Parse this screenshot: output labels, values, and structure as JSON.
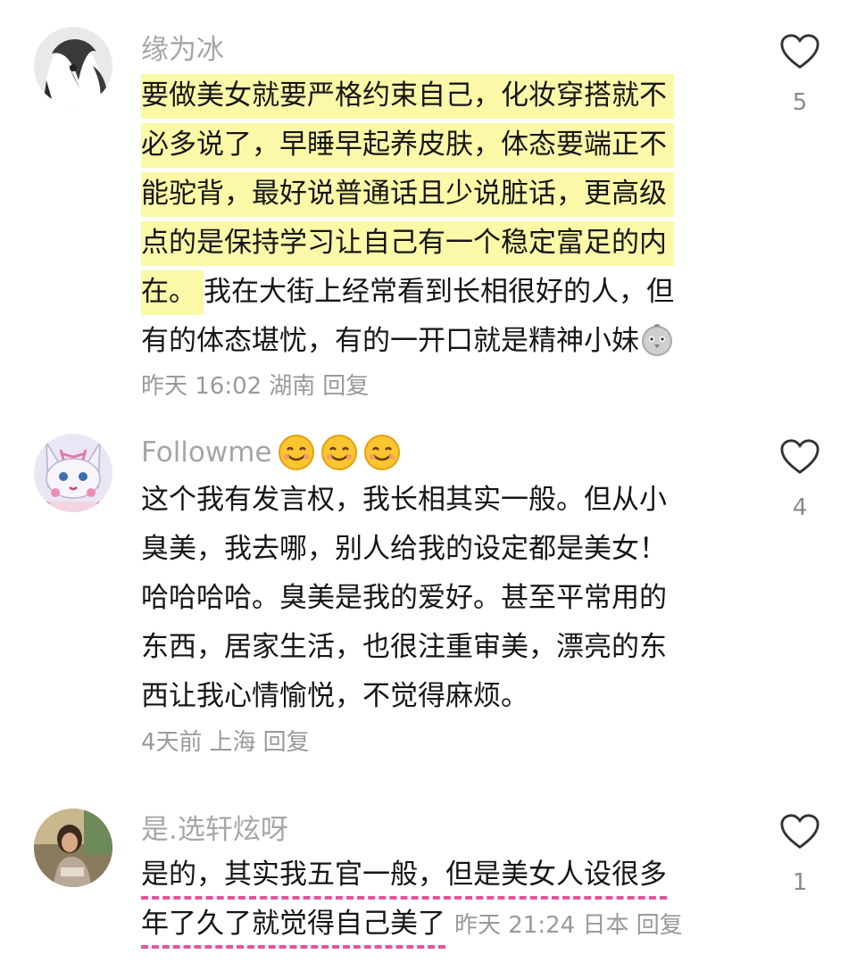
{
  "comments": [
    {
      "username": "缘为冰",
      "lines_highlighted": [
        "要做美女就要严格约束自己，化妆穿搭就不",
        "必多说了，早睡早起养皮肤，体态要端正不",
        "能驼背，最好说普通话且少说脏话，更高级",
        "点的是保持学习让自己有一个稳定富足的内"
      ],
      "line5_highlighted": "在。",
      "line5_rest": "我在大街上经常看到长相很好的人，但",
      "line6": "有的体态堪忧，有的一开口就是精神小妹",
      "line6_emoji": "chick-emoji",
      "time": "昨天 16:02",
      "location": "湖南",
      "reply_label": "回复",
      "likes": "5"
    },
    {
      "username": "Followme",
      "username_emoji": "smile-emoji",
      "lines": [
        "这个我有发言权，我长相其实一般。但从小",
        "臭美，我去哪，别人给我的设定都是美女！",
        "哈哈哈哈。臭美是我的爱好。甚至平常用的",
        "东西，居家生活，也很注重审美，漂亮的东",
        "西让我心情愉悦，不觉得麻烦。"
      ],
      "time": "4天前",
      "location": "上海",
      "reply_label": "回复",
      "likes": "4"
    },
    {
      "username": "是.选轩炫呀",
      "lines": [
        "是的，其实我五官一般，但是美女人设很多",
        "年了久了就觉得自己美了"
      ],
      "time": "昨天 21:24",
      "location": "日本",
      "reply_label": "回复",
      "likes": "1"
    }
  ],
  "colors": {
    "highlight": "#fbf8a8",
    "dash_underline": "#e4549c",
    "username": "#a6a6a6",
    "meta": "#9a9a9a"
  },
  "icons": {
    "like": "heart-outline-icon"
  }
}
